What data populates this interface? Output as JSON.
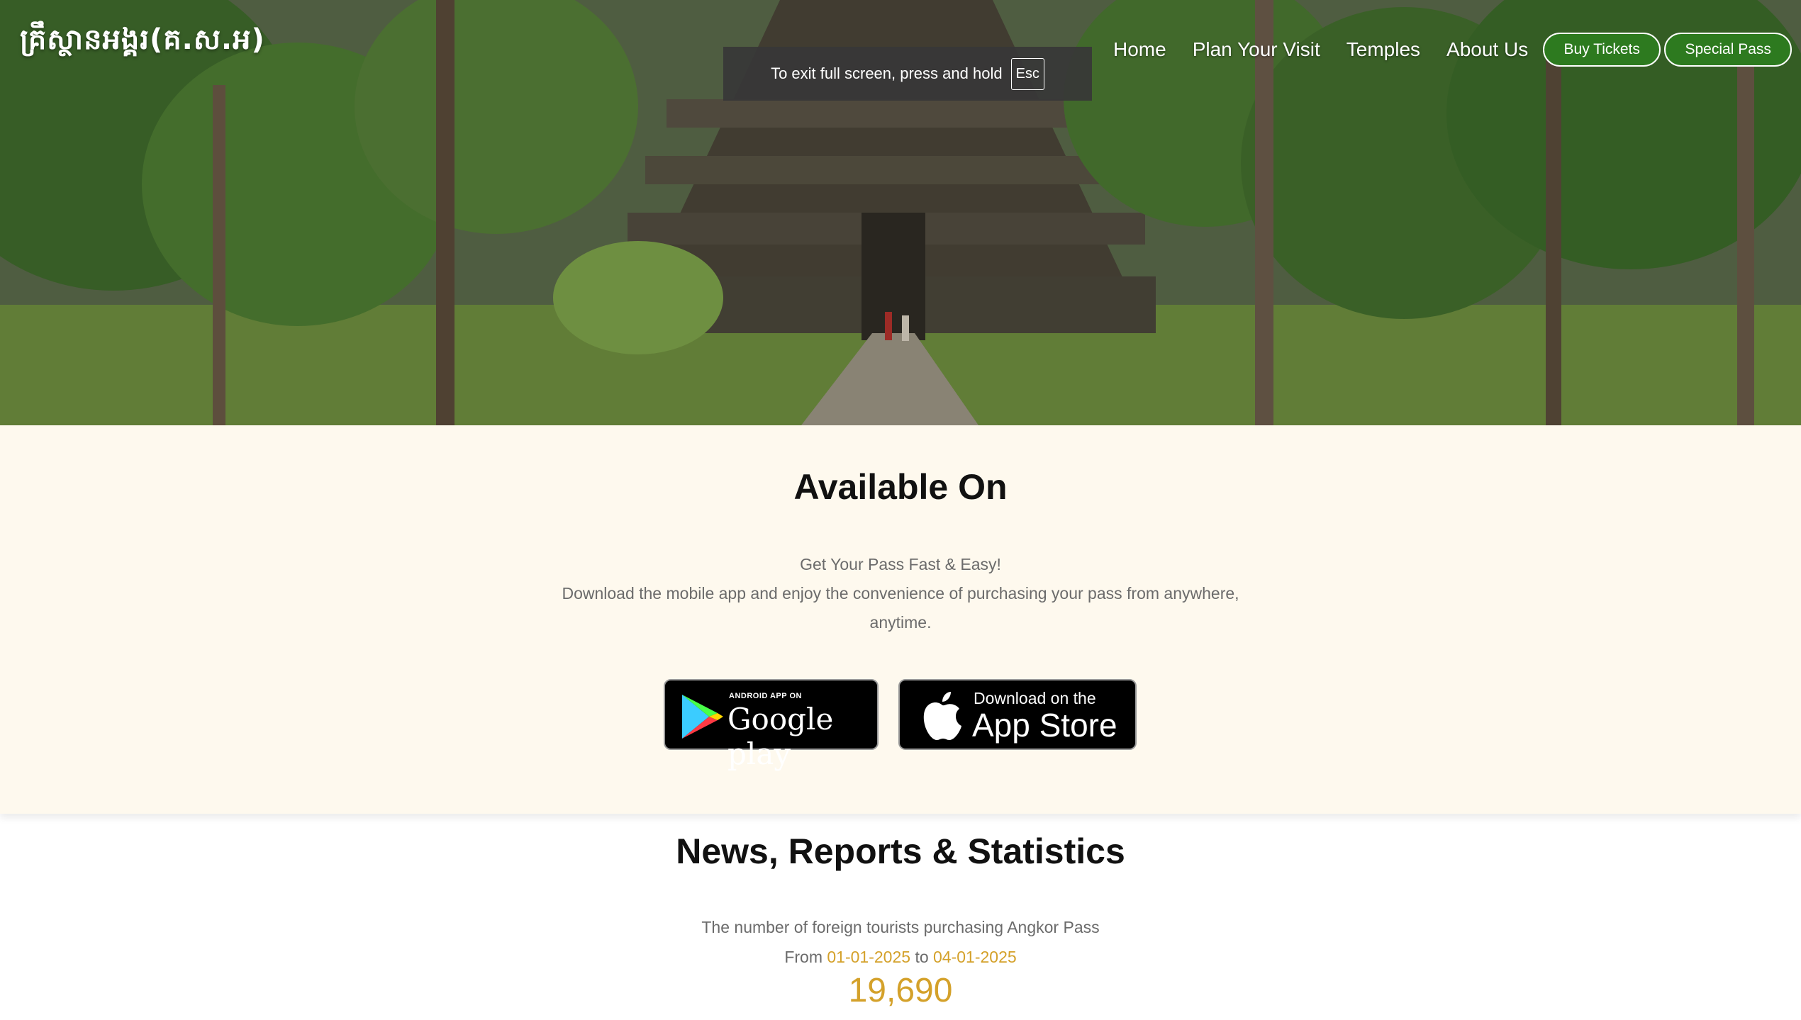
{
  "header": {
    "brand": "គ្រឹស្ថានអង្គរ(គ.ស.អ)",
    "nav": [
      "Home",
      "Plan Your Visit",
      "Temples",
      "About Us"
    ],
    "buy_tickets": "Buy Tickets",
    "special_pass": "Special Pass"
  },
  "fullscreen_notice": {
    "text": "To exit full screen, press and hold",
    "key": "Esc"
  },
  "available": {
    "title": "Available On",
    "tagline": "Get Your Pass Fast & Easy!",
    "description": "Download the mobile app and enjoy the convenience of purchasing your pass from anywhere, anytime.",
    "google_play": {
      "small": "ANDROID APP ON",
      "big": "Google play"
    },
    "app_store": {
      "small": "Download on the",
      "big": "App Store"
    }
  },
  "news": {
    "title": "News, Reports & Statistics",
    "description": "The number of foreign tourists purchasing Angkor Pass",
    "from_label": "From",
    "from_date": "01-01-2025",
    "to_label": "to",
    "to_date": "04-01-2025",
    "count": "19,690"
  },
  "colors": {
    "accent_gold": "#d4a12a",
    "button_green": "#2d7a1f",
    "cream_bg": "#fef9ee"
  }
}
